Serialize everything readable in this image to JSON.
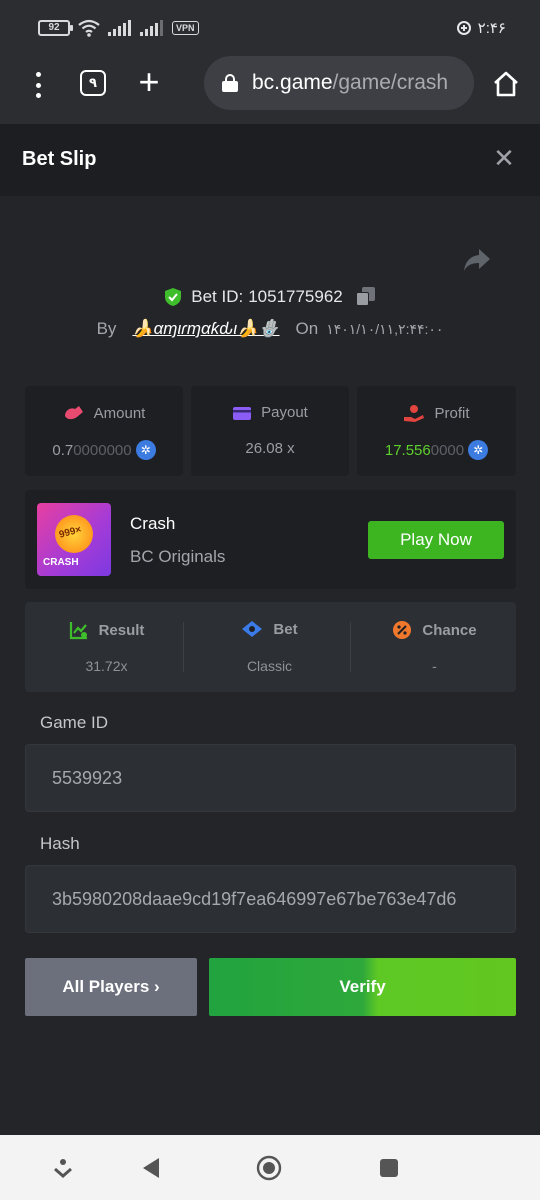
{
  "status_bar": {
    "battery": "92",
    "vpn": "VPN",
    "time": "۲:۴۶"
  },
  "browser": {
    "tab_count": "۹",
    "url_host": "bc.game",
    "url_path": "/game/crash"
  },
  "slip": {
    "title": "Bet Slip",
    "bet_id_label": "Bet ID:",
    "bet_id": "1051775962",
    "by_label": "By",
    "username": "🍌αɱιɾɱαƙԃι🍌🪬",
    "on_label": "On",
    "date": "۱۴۰۱/۱۰/۱۱,۲:۴۴:۰۰"
  },
  "stats": {
    "amount": {
      "label": "Amount",
      "value_main": "0.7",
      "value_dim": "0000000"
    },
    "payout": {
      "label": "Payout",
      "value": "26.08 x"
    },
    "profit": {
      "label": "Profit",
      "value_main": "17.556",
      "value_dim": "0000"
    }
  },
  "game": {
    "thumb_number": "999×",
    "thumb_label": "CRASH",
    "name": "Crash",
    "provider": "BC Originals",
    "play_label": "Play Now"
  },
  "result": {
    "result_label": "Result",
    "result_value": "31.72x",
    "bet_label": "Bet",
    "bet_value": "Classic",
    "chance_label": "Chance",
    "chance_value": "-"
  },
  "fields": {
    "game_id_label": "Game ID",
    "game_id": "5539923",
    "hash_label": "Hash",
    "hash": "3b5980208daae9cd19f7ea646997e67be763e47d6"
  },
  "actions": {
    "players_label": "All Players ›",
    "verify_label": "Verify"
  },
  "colors": {
    "accent_green": "#3cb521",
    "profit_green": "#5fcf2d",
    "amount_pink": "#e94a6f",
    "payout_purple": "#8b5cf6",
    "profit_red": "#e2443f"
  }
}
